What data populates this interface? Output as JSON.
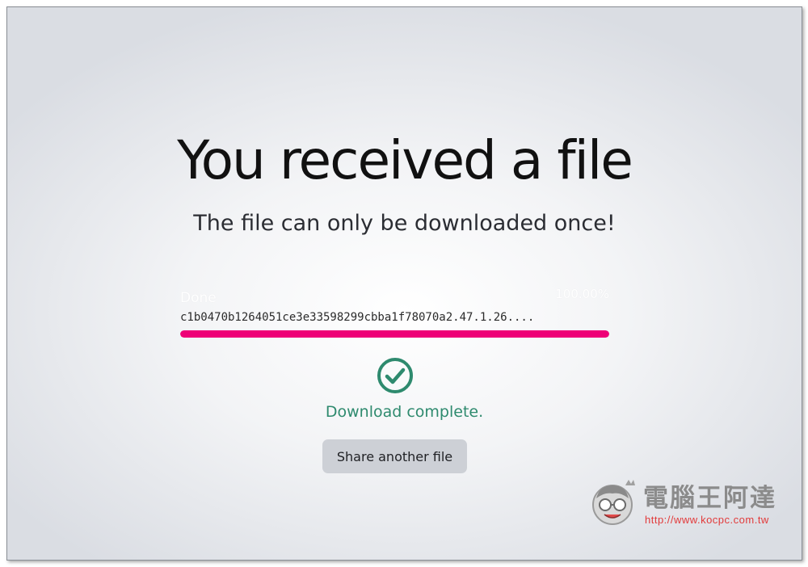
{
  "page": {
    "title": "You received a file",
    "subtitle": "The file can only be downloaded once!"
  },
  "transfer": {
    "status": "Done",
    "percent_text": "100.00%",
    "percent": 100,
    "file_name": "c1b0470b1264051ce3e33598299cbba1f78070a2.47.1.26....",
    "bar_color": "#ee0077"
  },
  "result": {
    "icon": "check-circle-icon",
    "message": "Download complete.",
    "color": "#2e8a6e"
  },
  "actions": {
    "share_label": "Share another file"
  },
  "watermark": {
    "brand": "電腦王阿達",
    "url": "http://www.kocpc.com.tw"
  }
}
